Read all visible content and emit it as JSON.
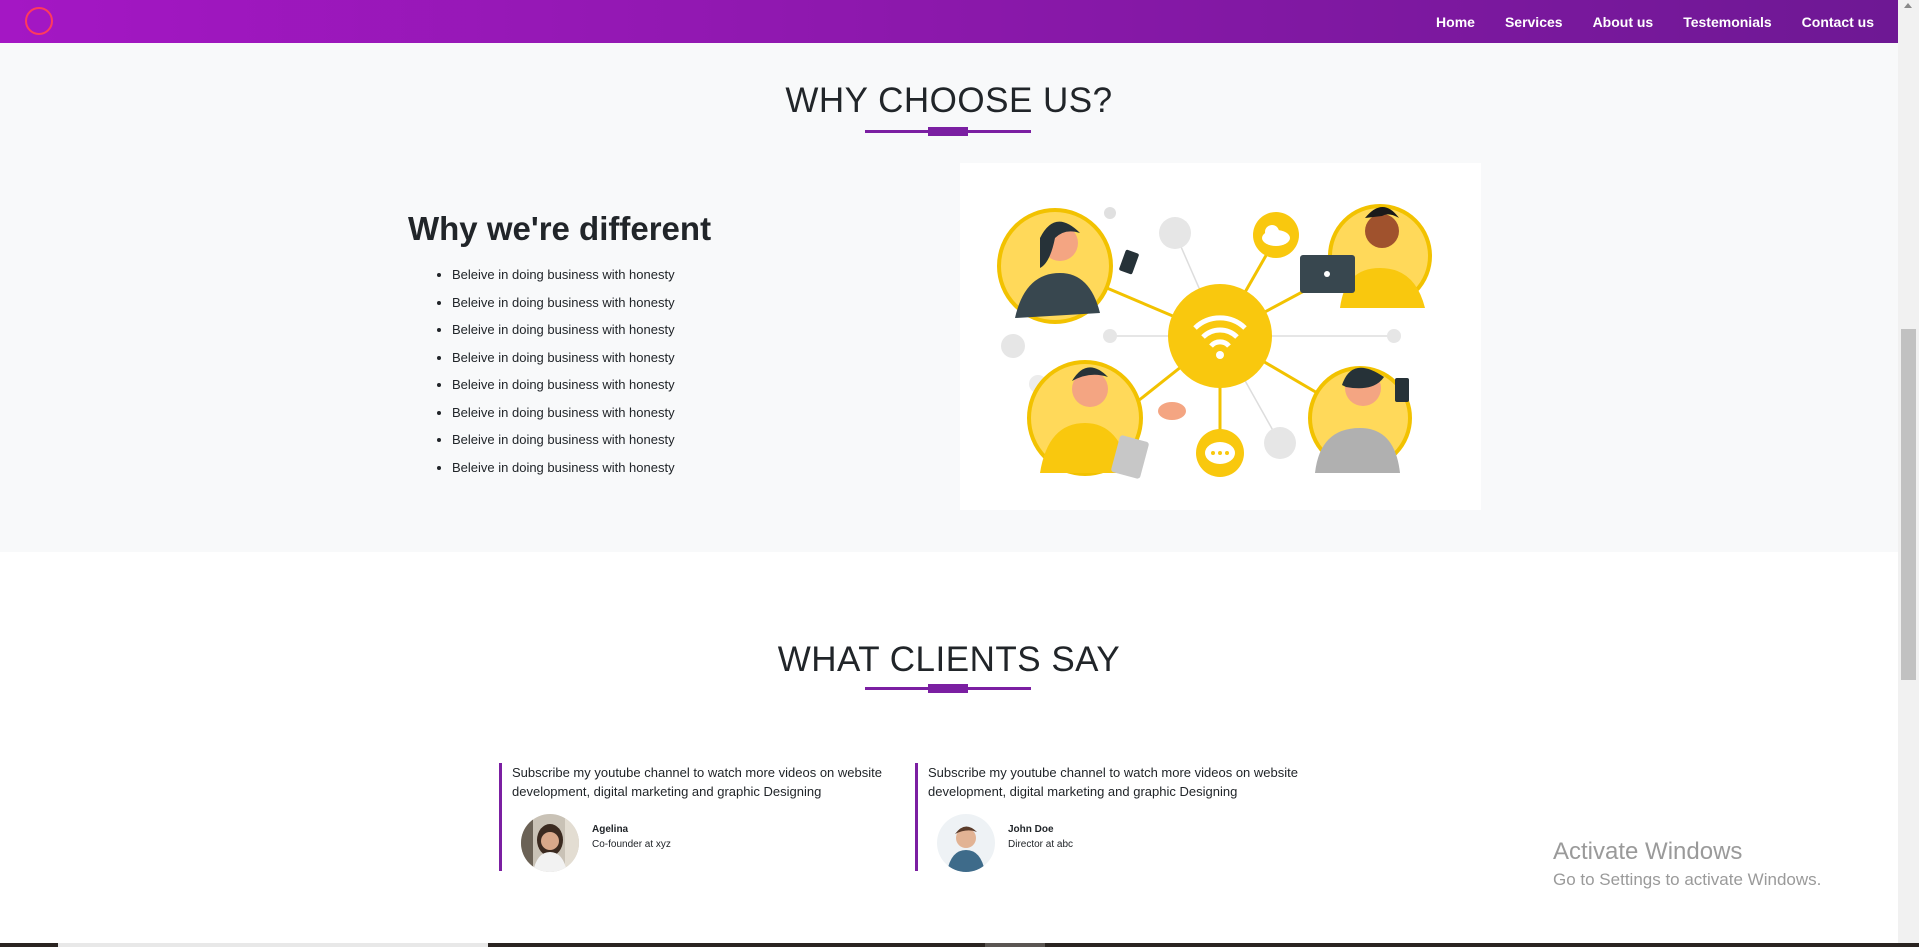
{
  "navbar": {
    "links": [
      "Home",
      "Services",
      "About us",
      "Testemonials",
      "Contact us"
    ]
  },
  "why": {
    "heading": "WHY CHOOSE US?",
    "subheading": "Why we're different",
    "points": [
      "Beleive in doing business with honesty",
      "Beleive in doing business with honesty",
      "Beleive in doing business with honesty",
      "Beleive in doing business with honesty",
      "Beleive in doing business with honesty",
      "Beleive in doing business with honesty",
      "Beleive in doing business with honesty",
      "Beleive in doing business with honesty"
    ]
  },
  "clients": {
    "heading": "WHAT CLIENTS SAY",
    "testimonials": [
      {
        "quote": "Subscribe my youtube channel to watch more videos on website development, digital marketing and graphic Designing",
        "name": "Agelina",
        "role": "Co-founder at xyz"
      },
      {
        "quote": "Subscribe my youtube channel to watch more videos on website development, digital marketing and graphic Designing",
        "name": "John Doe",
        "role": "Director at abc"
      }
    ]
  },
  "windows_notice": {
    "title": "Activate Windows",
    "subtitle": "Go to Settings to activate Windows."
  },
  "colors": {
    "accent": "#7b1fa2",
    "nav_gradient_start": "#a417c4",
    "nav_gradient_end": "#6e1894",
    "illustration_yellow": "#f9c80e"
  }
}
